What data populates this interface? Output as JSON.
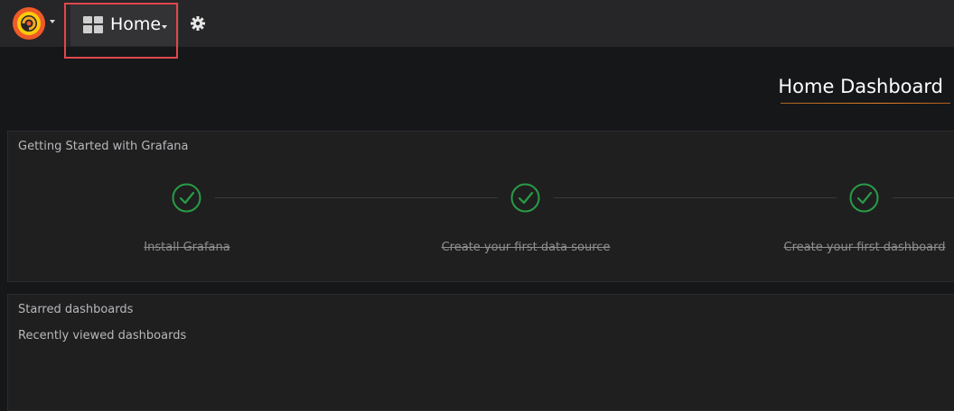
{
  "topbar": {
    "logo_icon": "grafana-logo-icon",
    "home_button": {
      "label": "Home",
      "icon": "dashboard-grid-icon"
    },
    "settings_icon": "gear-icon"
  },
  "dashboard": {
    "title": "Home Dashboard"
  },
  "getting_started": {
    "title": "Getting Started with Grafana",
    "steps": [
      {
        "label": "Install Grafana",
        "completed": true,
        "icon": "check-circle-icon"
      },
      {
        "label": "Create your first data source",
        "completed": true,
        "icon": "check-circle-icon"
      },
      {
        "label": "Create your first dashboard",
        "completed": true,
        "icon": "check-circle-icon"
      }
    ]
  },
  "lists": {
    "starred_title": "Starred dashboards",
    "recent_title": "Recently viewed dashboards"
  },
  "colors": {
    "background": "#161719",
    "topbar": "#262628",
    "panel": "#1f1f20",
    "check_green": "#299c46",
    "accent_orange": "#e37f23",
    "highlight_red": "#e0474c"
  }
}
